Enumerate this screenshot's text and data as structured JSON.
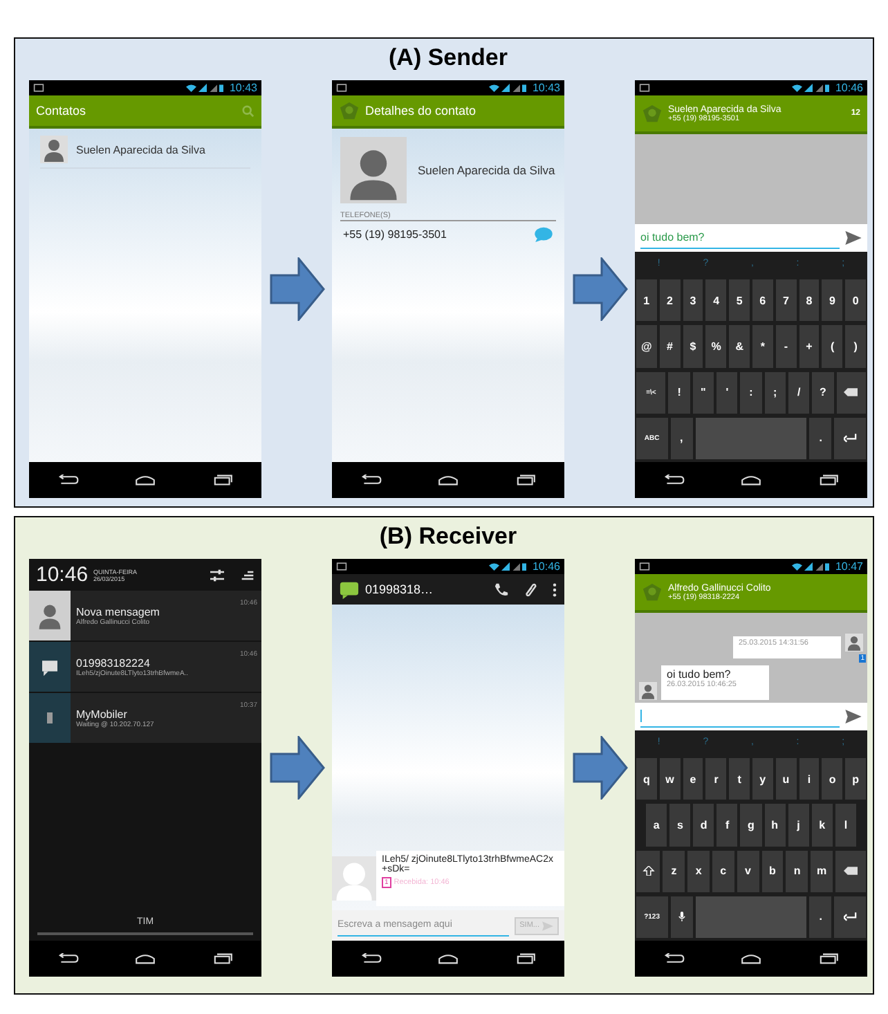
{
  "panels": [
    {
      "kind": "sender",
      "title": "(A) Sender",
      "phones": [
        {
          "kind": "contacts",
          "time": "10:43",
          "title": "Contatos",
          "contacts": [
            "Suelen Aparecida da Silva"
          ]
        },
        {
          "kind": "contact_detail",
          "time": "10:43",
          "title": "Detalhes do contato",
          "name": "Suelen Aparecida da Silva",
          "section": "TELEFONE(S)",
          "phone": "+55 (19) 98195-3501"
        },
        {
          "kind": "chat",
          "time": "10:46",
          "contact": "Suelen Aparecida da Silva",
          "number": "+55 (19) 98195-3501",
          "count": "12",
          "input_value": "oi tudo bem?",
          "keyboard": {
            "suggestions": [
              "!",
              "?",
              ",",
              ":",
              ";"
            ],
            "key_lines": [
              [
                {
                  "kind": "char",
                  "label": "1"
                },
                {
                  "kind": "char",
                  "label": "2"
                },
                {
                  "kind": "char",
                  "label": "3"
                },
                {
                  "kind": "char",
                  "label": "4"
                },
                {
                  "kind": "char",
                  "label": "5"
                },
                {
                  "kind": "char",
                  "label": "6"
                },
                {
                  "kind": "char",
                  "label": "7"
                },
                {
                  "kind": "char",
                  "label": "8"
                },
                {
                  "kind": "char",
                  "label": "9"
                },
                {
                  "kind": "char",
                  "label": "0"
                }
              ],
              [
                {
                  "kind": "char",
                  "label": "@"
                },
                {
                  "kind": "char",
                  "label": "#"
                },
                {
                  "kind": "char",
                  "label": "$"
                },
                {
                  "kind": "char",
                  "label": "%"
                },
                {
                  "kind": "char",
                  "label": "&"
                },
                {
                  "kind": "char",
                  "label": "*"
                },
                {
                  "kind": "char",
                  "label": "-"
                },
                {
                  "kind": "char",
                  "label": "+"
                },
                {
                  "kind": "char",
                  "label": "("
                },
                {
                  "kind": "char",
                  "label": ")"
                }
              ],
              [
                {
                  "kind": "small",
                  "label": "=\\<"
                },
                {
                  "kind": "char",
                  "label": "!"
                },
                {
                  "kind": "char",
                  "label": "\""
                },
                {
                  "kind": "char",
                  "label": "'"
                },
                {
                  "kind": "char",
                  "label": ":"
                },
                {
                  "kind": "char",
                  "label": ";"
                },
                {
                  "kind": "char",
                  "label": "/"
                },
                {
                  "kind": "char",
                  "label": "?"
                },
                {
                  "kind": "backspace"
                }
              ],
              [
                {
                  "kind": "small",
                  "label": "ABC"
                },
                {
                  "kind": "char",
                  "label": ","
                },
                {
                  "kind": "space"
                },
                {
                  "kind": "char",
                  "label": "."
                },
                {
                  "kind": "enter"
                }
              ]
            ]
          }
        }
      ]
    },
    {
      "kind": "receiver",
      "title": "(B) Receiver",
      "phones": [
        {
          "kind": "notifications",
          "time": "10:46",
          "day": "QUINTA-FEIRA",
          "date": "26/03/2015",
          "items": [
            {
              "kind": "contact",
              "title": "Nova mensagem",
              "subtitle": "Alfredo Gallinucci Colito",
              "time": "10:46"
            },
            {
              "kind": "sms",
              "title": "019983182224",
              "subtitle": "ILeh5/zjOinute8LTlyto13trhBfwmeA..",
              "time": "10:46"
            },
            {
              "kind": "app",
              "title": "MyMobiler",
              "subtitle": "Waiting @ 10.202.70.127",
              "time": "10:37"
            }
          ],
          "carrier": "TIM"
        },
        {
          "kind": "sms_thread",
          "time": "10:46",
          "title": "01998318…",
          "message": "ILeh5/ zjOinute8LTlyto13trhBfwmeAC2x+sDk=",
          "badge": "1",
          "status": "Recebida: 10:46",
          "placeholder": "Escreva a mensagem aqui",
          "send": "SIM..."
        },
        {
          "kind": "chat",
          "time": "10:47",
          "contact": "Alfredo Gallinucci Colito",
          "number": "+55 (19) 98318-2224",
          "messages": [
            {
              "kind": "outgoing",
              "date": "25.03.2015 14:31:56",
              "badge": "1"
            },
            {
              "kind": "incoming",
              "text": "oi tudo bem?",
              "date": "26.03.2015 10:46:25"
            }
          ],
          "keyboard": {
            "suggestions": [
              "!",
              "?",
              ",",
              ":",
              ";"
            ],
            "key_lines": [
              [
                {
                  "kind": "char",
                  "label": "q"
                },
                {
                  "kind": "char",
                  "label": "w"
                },
                {
                  "kind": "char",
                  "label": "e"
                },
                {
                  "kind": "char",
                  "label": "r"
                },
                {
                  "kind": "char",
                  "label": "t"
                },
                {
                  "kind": "char",
                  "label": "y"
                },
                {
                  "kind": "char",
                  "label": "u"
                },
                {
                  "kind": "char",
                  "label": "i"
                },
                {
                  "kind": "char",
                  "label": "o"
                },
                {
                  "kind": "char",
                  "label": "p"
                }
              ],
              [
                {
                  "kind": "char",
                  "label": "a"
                },
                {
                  "kind": "char",
                  "label": "s"
                },
                {
                  "kind": "char",
                  "label": "d"
                },
                {
                  "kind": "char",
                  "label": "f"
                },
                {
                  "kind": "char",
                  "label": "g"
                },
                {
                  "kind": "char",
                  "label": "h"
                },
                {
                  "kind": "char",
                  "label": "j"
                },
                {
                  "kind": "char",
                  "label": "k"
                },
                {
                  "kind": "char",
                  "label": "l"
                }
              ],
              [
                {
                  "kind": "shift"
                },
                {
                  "kind": "char",
                  "label": "z"
                },
                {
                  "kind": "char",
                  "label": "x"
                },
                {
                  "kind": "char",
                  "label": "c"
                },
                {
                  "kind": "char",
                  "label": "v"
                },
                {
                  "kind": "char",
                  "label": "b"
                },
                {
                  "kind": "char",
                  "label": "n"
                },
                {
                  "kind": "char",
                  "label": "m"
                },
                {
                  "kind": "backspace"
                }
              ],
              [
                {
                  "kind": "small",
                  "label": "?123"
                },
                {
                  "kind": "mic"
                },
                {
                  "kind": "space"
                },
                {
                  "kind": "char",
                  "label": "."
                },
                {
                  "kind": "enter"
                }
              ]
            ]
          }
        }
      ]
    }
  ]
}
